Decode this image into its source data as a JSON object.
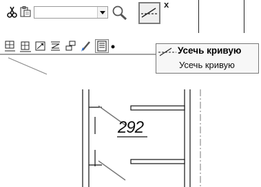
{
  "toolbar": {
    "combo_value": "",
    "trim_curve_label": "Усечь кривую",
    "close_glyph": "x"
  },
  "tooltip": {
    "title": "Усечь кривую",
    "description": "Усечь кривую"
  },
  "drawing": {
    "dimension_value": "292"
  },
  "colors": {
    "toolbar_bg": "#ffffff",
    "highlight_border": "#7c7c7c",
    "tooltip_bg": "#f7f7f7",
    "tooltip_border": "#777777"
  }
}
